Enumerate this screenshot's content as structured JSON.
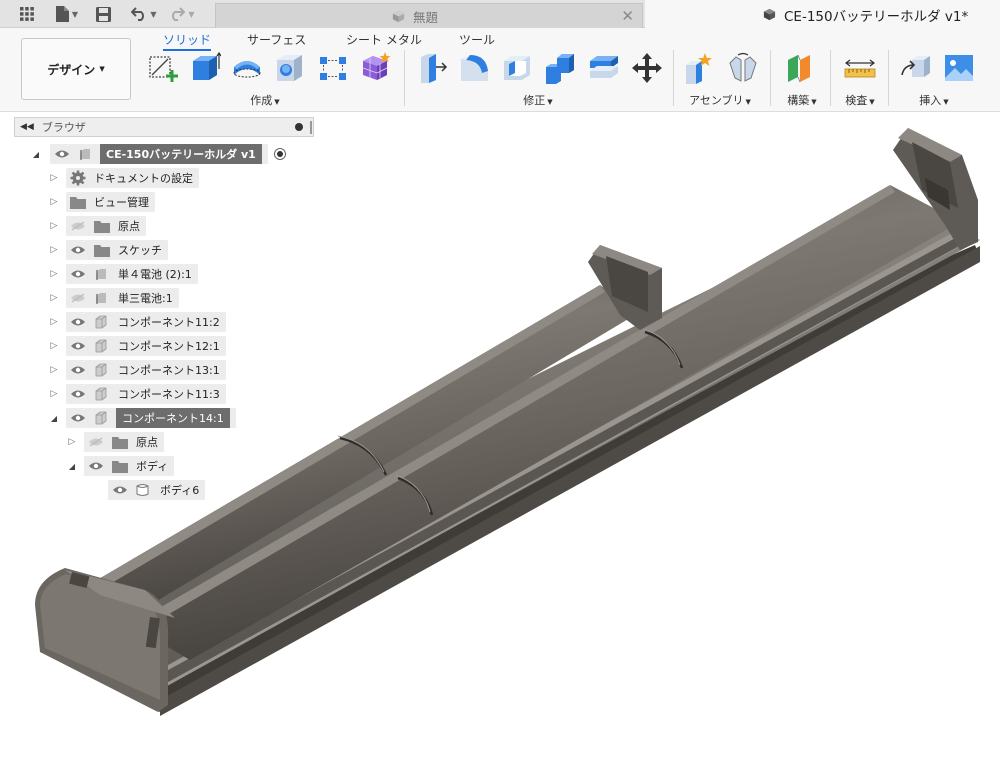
{
  "tabs": {
    "inactive_title": "無題",
    "active_title": "CE-150バッテリーホルダ v1*"
  },
  "ribbon": {
    "workspace": "デザイン",
    "tabs": [
      {
        "label": "ソリッド",
        "active": true
      },
      {
        "label": "サーフェス",
        "active": false
      },
      {
        "label": "シート メタル",
        "active": false
      },
      {
        "label": "ツール",
        "active": false
      }
    ],
    "groups": {
      "create": "作成",
      "modify": "修正",
      "assemble": "アセンブリ",
      "construct": "構築",
      "inspect": "検査",
      "insert": "挿入"
    }
  },
  "browser": {
    "title": "ブラウザ",
    "root": "CE-150バッテリーホルダ v1",
    "items": [
      {
        "label": "ドキュメントの設定",
        "icon": "gear-icon"
      },
      {
        "label": "ビュー管理",
        "icon": "folder-icon"
      },
      {
        "label": "原点",
        "icon": "folder-icon",
        "hidden": true
      },
      {
        "label": "スケッチ",
        "icon": "folder-icon"
      },
      {
        "label": "単４電池 (2):1",
        "icon": "component-link-icon"
      },
      {
        "label": "単三電池:1",
        "icon": "component-link-icon",
        "hidden": true
      },
      {
        "label": "コンポーネント11:2",
        "icon": "component-icon"
      },
      {
        "label": "コンポーネント12:1",
        "icon": "component-icon"
      },
      {
        "label": "コンポーネント13:1",
        "icon": "component-icon"
      },
      {
        "label": "コンポーネント11:3",
        "icon": "component-icon"
      },
      {
        "label": "コンポーネント14:1",
        "icon": "component-icon",
        "selected": true
      }
    ],
    "sub_items": [
      {
        "label": "原点",
        "icon": "folder-icon",
        "hidden": true
      },
      {
        "label": "ボディ",
        "icon": "folder-icon"
      },
      {
        "label": "ボディ6",
        "icon": "body-icon"
      }
    ]
  },
  "colors": {
    "accent": "#1e6fd9",
    "model_dark": "#4a4641",
    "model_mid": "#6f6a64",
    "model_light": "#8f8a84"
  }
}
